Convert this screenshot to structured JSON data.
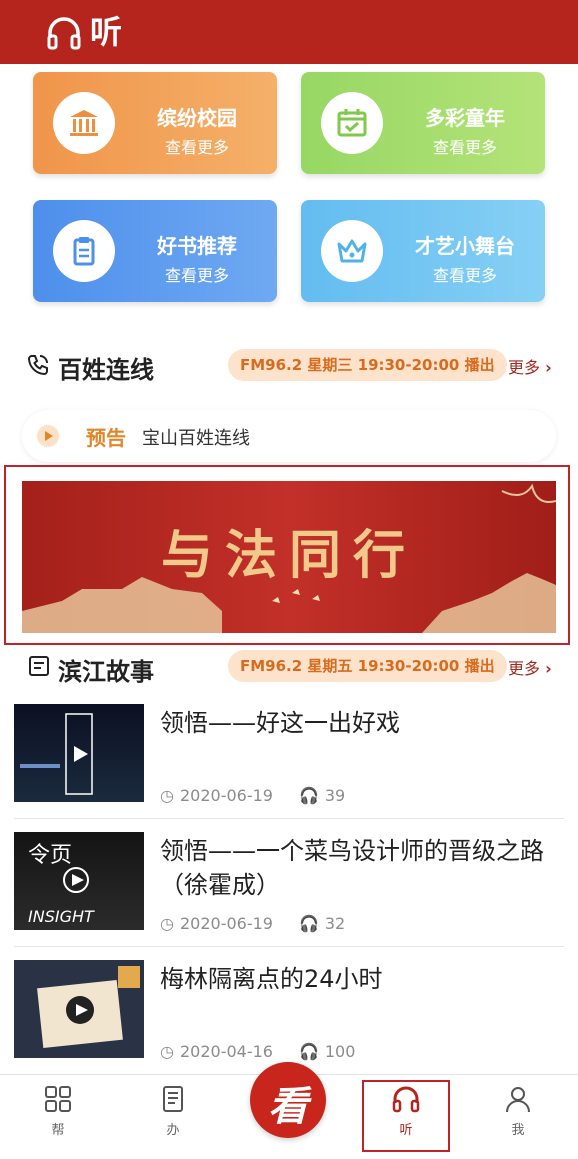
{
  "header": {
    "title": "听",
    "icon": "headphones-icon"
  },
  "cards": [
    {
      "title": "缤纷校园",
      "more": "查看更多",
      "icon": "bank-icon"
    },
    {
      "title": "多彩童年",
      "more": "查看更多",
      "icon": "calendar-check-icon"
    },
    {
      "title": "好书推荐",
      "more": "查看更多",
      "icon": "document-icon"
    },
    {
      "title": "才艺小舞台",
      "more": "查看更多",
      "icon": "crown-icon"
    }
  ],
  "section1": {
    "title": "百姓连线",
    "schedule": "FM96.2 星期三 19:30-20:00 播出",
    "more": "更多",
    "icon": "phone-icon"
  },
  "notice": {
    "tag": "预告",
    "text": "宝山百姓连线"
  },
  "banner": {
    "title": "与法同行"
  },
  "section2": {
    "title": "滨江故事",
    "schedule": "FM96.2 星期五 19:30-20:00 播出",
    "more": "更多",
    "icon": "news-icon"
  },
  "items": [
    {
      "title": "领悟——好这一出好戏",
      "date": "2020-06-19",
      "plays": "39"
    },
    {
      "title": "领悟——一个菜鸟设计师的晋级之路（徐霍成）",
      "date": "2020-06-19",
      "plays": "32"
    },
    {
      "title": "梅林隔离点的24小时",
      "date": "2020-04-16",
      "plays": "100"
    }
  ],
  "tabs": [
    {
      "label": "帮",
      "icon": "grid-icon"
    },
    {
      "label": "办",
      "icon": "book-icon"
    },
    {
      "label": "看",
      "icon": "center-logo-icon"
    },
    {
      "label": "听",
      "icon": "headphones-icon",
      "active": true
    },
    {
      "label": "我",
      "icon": "user-icon"
    }
  ],
  "colors": {
    "primary": "#b5251d",
    "accent": "#e0862a"
  }
}
